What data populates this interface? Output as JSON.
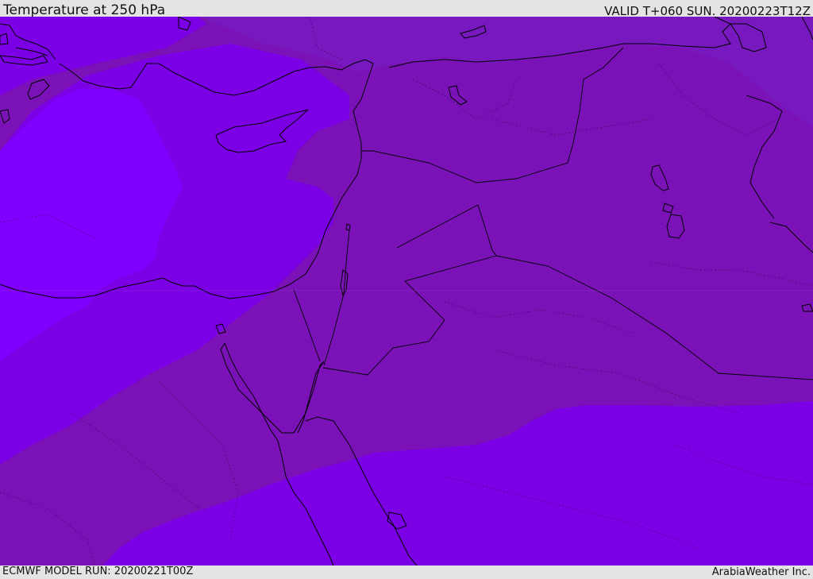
{
  "header": {
    "title": "Temperature at 250 hPa",
    "valid_time": "VALID T+060 SUN. 20200223T12Z"
  },
  "footer": {
    "model_run": "ECMWF MODEL RUN: 20200221T00Z",
    "credit": "ArabiaWeather Inc."
  },
  "map": {
    "colors": {
      "coldest_band": "#8000ff",
      "cold_band": "#7b00e6",
      "mid_band": "#7a12b7",
      "mid_band_edge": "#7818bf",
      "coastline": "#000000",
      "frame_background": "#e4e4e4"
    }
  }
}
